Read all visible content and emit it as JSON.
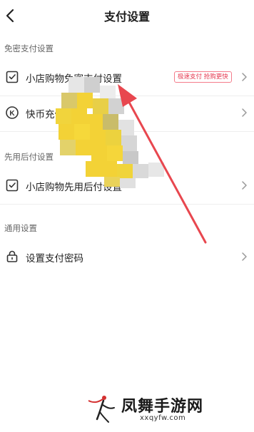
{
  "header": {
    "title": "支付设置"
  },
  "sections": {
    "nopass": {
      "title": "免密支付设置",
      "items": [
        {
          "label": "小店购物免密支付设置",
          "badge": "极速支付 抢购更快"
        },
        {
          "label": "快币充值"
        }
      ]
    },
    "paylater": {
      "title": "先用后付设置",
      "items": [
        {
          "label": "小店购物先用后付设置"
        }
      ]
    },
    "general": {
      "title": "通用设置",
      "items": [
        {
          "label": "设置支付密码"
        }
      ]
    }
  },
  "watermark": {
    "logo_text": "凤舞手游网",
    "url": "xxqyfw.com"
  },
  "colors": {
    "arrow": "#e8474f",
    "badge": "#e53950",
    "mosaic_yellow": "#f3d236"
  }
}
